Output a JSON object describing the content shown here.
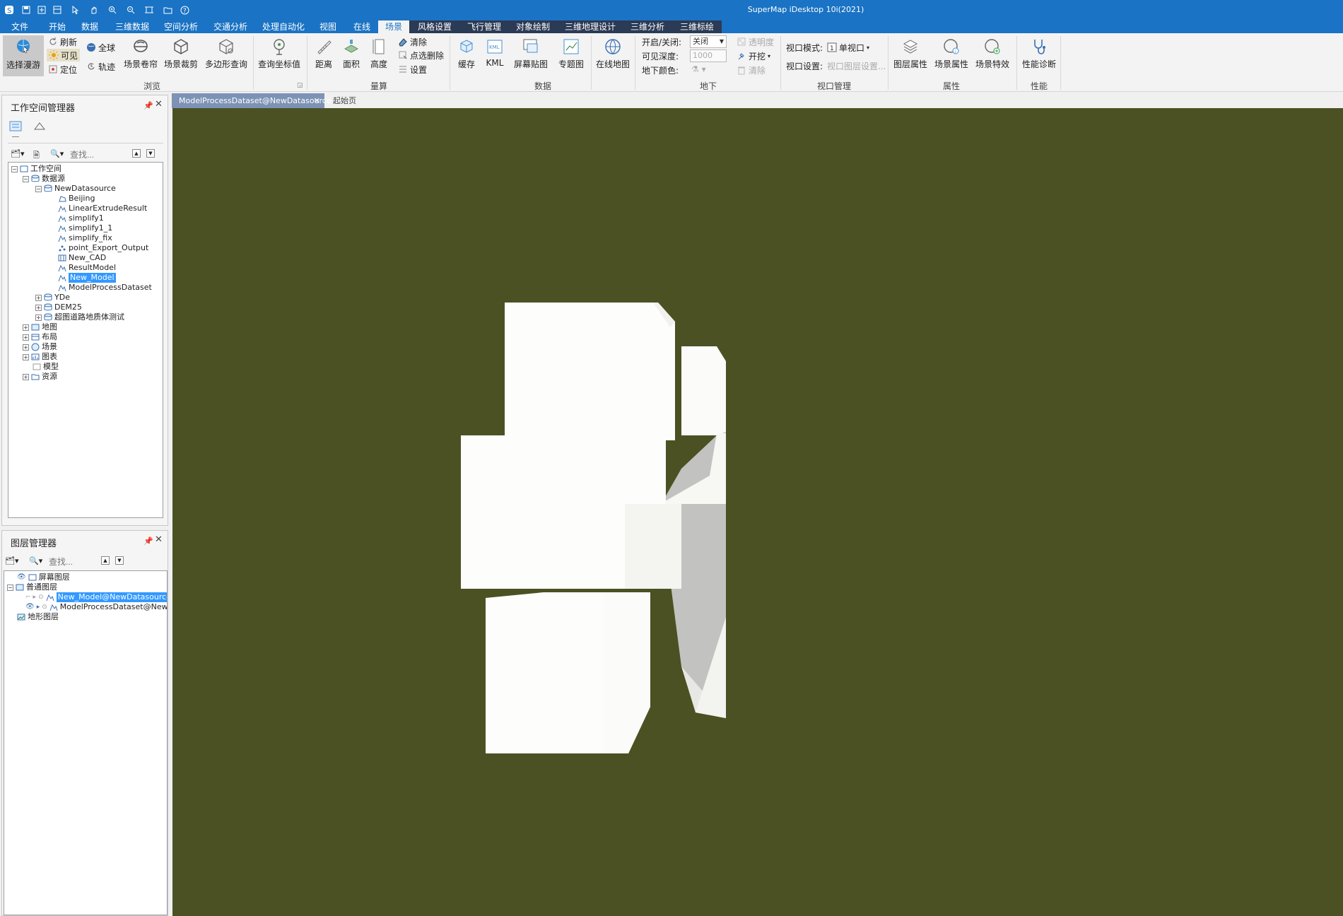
{
  "app": {
    "title": "SuperMap iDesktop 10i(2021)"
  },
  "menu": {
    "tabs": [
      "文件",
      "开始",
      "数据",
      "三维数据",
      "空间分析",
      "交通分析",
      "处理自动化",
      "视图",
      "在线",
      "场景",
      "风格设置",
      "飞行管理",
      "对象绘制",
      "三维地理设计",
      "三维分析",
      "三维标绘"
    ],
    "active": "场景"
  },
  "ribbon": {
    "browse": {
      "select_roam": "选择漫游",
      "refresh": "刷新",
      "visible": "可见",
      "locate": "定位",
      "globe": "全球",
      "track": "轨迹",
      "roller": "场景卷帘",
      "clip": "场景裁剪",
      "polygon_query": "多边形查询",
      "query_coord": "查询坐标值",
      "label": "浏览"
    },
    "measure": {
      "distance": "距离",
      "area": "面积",
      "height": "高度",
      "clear": "清除",
      "point_delete": "点选删除",
      "settings": "设置",
      "label": "量算"
    },
    "data": {
      "cache": "缓存",
      "kml": "KML",
      "screen_map": "屏幕贴图",
      "thematic": "专题图",
      "online_map": "在线地图",
      "label": "数据"
    },
    "underground": {
      "on_off": "开启/关闭:",
      "on_off_value": "关闭",
      "visible_depth": "可见深度:",
      "visible_depth_value": "1000",
      "ground_color": "地下颜色:",
      "transparency": "透明度",
      "excavate": "开挖",
      "clear": "清除",
      "label": "地下"
    },
    "viewport": {
      "mode_label": "视口模式:",
      "mode_value": "单视口",
      "settings_label": "视口设置:",
      "settings_value": "视口图层设置...",
      "label": "视口管理"
    },
    "properties": {
      "layer_props": "图层属性",
      "scene_props": "场景属性",
      "scene_effects": "场景特效",
      "label": "属性"
    },
    "performance": {
      "diagnose": "性能诊断",
      "label": "性能"
    }
  },
  "workspace_panel": {
    "title": "工作空间管理器",
    "search_placeholder": "查找...",
    "tree": {
      "root": "工作空间",
      "datasources": "数据源",
      "new_datasource": "NewDatasource",
      "datasets": [
        "Beijing",
        "LinearExtrudeResult",
        "simplify1",
        "simplify1_1",
        "simplify_fix",
        "point_Export_Output",
        "New_CAD",
        "ResultModel",
        "New_Model",
        "ModelProcessDataset"
      ],
      "selected_dataset": "New_Model",
      "other_datasources": [
        "YDe",
        "DEM25",
        "超图道路地质体测试"
      ],
      "folders": [
        "地图",
        "布局",
        "场景",
        "图表",
        "模型",
        "资源"
      ]
    }
  },
  "layer_panel": {
    "title": "图层管理器",
    "search_placeholder": "查找...",
    "groups": {
      "screen": "屏幕图层",
      "normal": "普通图层",
      "terrain": "地形图层"
    },
    "layers": [
      "New_Model@NewDatasource",
      "ModelProcessDataset@NewI"
    ],
    "selected_layer": "New_Model@NewDatasource"
  },
  "doc_tabs": {
    "active": "ModelProcessDataset@NewDatasource",
    "other": "起始页"
  },
  "colors": {
    "titlebar": "#1a73c4",
    "scene_bg": "#4b5122",
    "model_face": "#fdfdfb",
    "model_shadow": "#b9b9b9"
  }
}
